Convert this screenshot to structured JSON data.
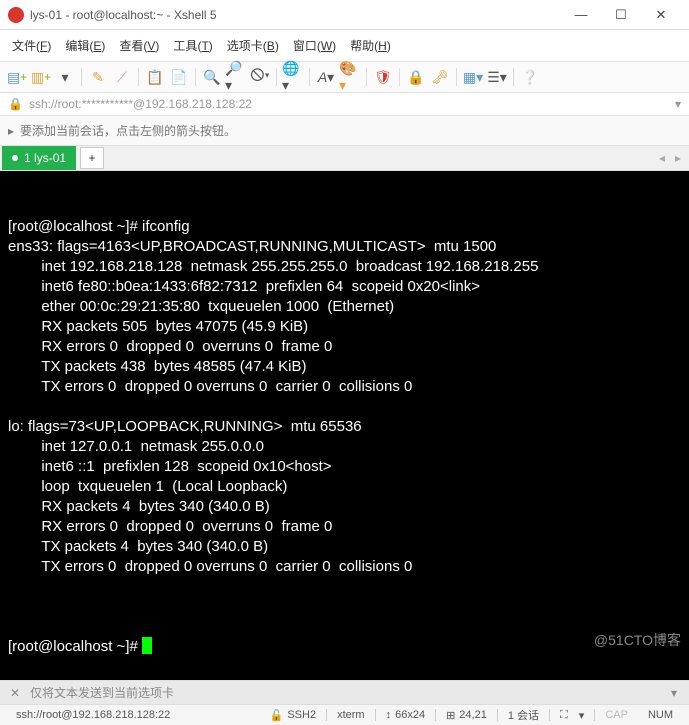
{
  "window": {
    "title": "lys-01 - root@localhost:~ - Xshell 5"
  },
  "menu": {
    "items": [
      {
        "label": "文件",
        "key": "F"
      },
      {
        "label": "编辑",
        "key": "E"
      },
      {
        "label": "查看",
        "key": "V"
      },
      {
        "label": "工具",
        "key": "T"
      },
      {
        "label": "选项卡",
        "key": "B"
      },
      {
        "label": "窗口",
        "key": "W"
      },
      {
        "label": "帮助",
        "key": "H"
      }
    ]
  },
  "address": {
    "url": "ssh://root:***********@192.168.218.128:22"
  },
  "notice": {
    "text": "要添加当前会话，点击左侧的箭头按钮。"
  },
  "tabs": {
    "active": {
      "index": "1",
      "name": "lys-01"
    }
  },
  "terminal": {
    "lines": [
      "[root@localhost ~]# ifconfig",
      "ens33: flags=4163<UP,BROADCAST,RUNNING,MULTICAST>  mtu 1500",
      "        inet 192.168.218.128  netmask 255.255.255.0  broadcast 192.168.218.255",
      "        inet6 fe80::b0ea:1433:6f82:7312  prefixlen 64  scopeid 0x20<link>",
      "        ether 00:0c:29:21:35:80  txqueuelen 1000  (Ethernet)",
      "        RX packets 505  bytes 47075 (45.9 KiB)",
      "        RX errors 0  dropped 0  overruns 0  frame 0",
      "        TX packets 438  bytes 48585 (47.4 KiB)",
      "        TX errors 0  dropped 0 overruns 0  carrier 0  collisions 0",
      "",
      "lo: flags=73<UP,LOOPBACK,RUNNING>  mtu 65536",
      "        inet 127.0.0.1  netmask 255.0.0.0",
      "        inet6 ::1  prefixlen 128  scopeid 0x10<host>",
      "        loop  txqueuelen 1  (Local Loopback)",
      "        RX packets 4  bytes 340 (340.0 B)",
      "        RX errors 0  dropped 0  overruns 0  frame 0",
      "        TX packets 4  bytes 340 (340.0 B)",
      "        TX errors 0  dropped 0 overruns 0  carrier 0  collisions 0",
      ""
    ],
    "prompt_final": "[root@localhost ~]# "
  },
  "bottom": {
    "send_text": "仅将文本发送到当前选项卡"
  },
  "status": {
    "conn": "ssh://root@192.168.218.128:22",
    "proto": "SSH2",
    "term": "xterm",
    "size": "66x24",
    "pos": "24,21",
    "sessions": "1 会话",
    "caps": "CAP",
    "num": "NUM"
  },
  "watermark": "@51CTO博客",
  "icons": {
    "new": "📄",
    "folder_add": "📁",
    "arrow": "▸",
    "pencil": "✎",
    "brush": "🖌",
    "copy": "📋",
    "paste": "📋",
    "search": "🔍",
    "a1": "🔎",
    "a2": "⌦",
    "globe": "🌐",
    "font": "A",
    "palette": "🎨",
    "eye": "🛡",
    "lock": "🔒",
    "key": "🗝",
    "board": "▦",
    "grid": "☰",
    "q": "❔"
  }
}
